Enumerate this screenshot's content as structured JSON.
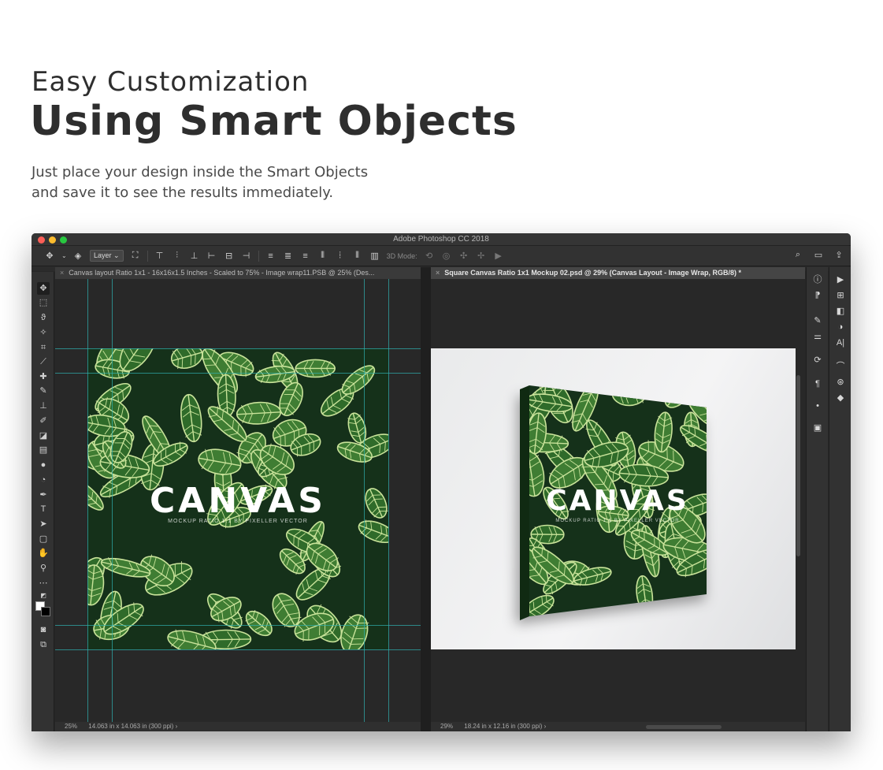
{
  "hero": {
    "subtitle": "Easy Customization",
    "title": "Using Smart Objects",
    "desc_line1": "Just place your design inside the Smart Objects",
    "desc_line2": "and save it to see the results immediately."
  },
  "app": {
    "window_title": "Adobe Photoshop CC 2018",
    "options": {
      "layer_select": "Layer",
      "mode_label": "3D Mode:"
    },
    "documents": [
      {
        "tab_close": "×",
        "tab_label": "Canvas layout Ratio 1x1 - 16x16x1.5 Inches - Scaled to 75% - Image wrap11.PSB @ 25% (Des...",
        "zoom": "25%",
        "doc_size": "14.063 in x 14.063 in (300 ppi)",
        "status_arrow": "›"
      },
      {
        "tab_close": "×",
        "tab_label": "Square Canvas Ratio 1x1 Mockup 02.psd @ 29% (Canvas Layout - Image Wrap, RGB/8) *",
        "zoom": "29%",
        "doc_size": "18.24 in x 12.16 in (300 ppi)",
        "status_arrow": "›"
      }
    ],
    "artwork": {
      "word": "CANVAS",
      "tagline": "MOCKUP RATIO 1:1 BY PIXELLER VECTOR"
    },
    "tools": [
      "move-tool",
      "marquee-tool",
      "lasso-tool",
      "magic-wand-tool",
      "crop-tool",
      "eyedropper-tool",
      "healing-tool",
      "brush-tool",
      "stamp-tool",
      "history-brush-tool",
      "eraser-tool",
      "gradient-tool",
      "blur-tool",
      "dodge-tool",
      "pen-tool",
      "type-tool",
      "path-selection-tool",
      "shape-tool",
      "hand-tool",
      "zoom-tool",
      "more-tools"
    ],
    "colors": {
      "accent_guide": "#2fb0b0",
      "window_bg": "#282828",
      "leaf_dark": "#15311a",
      "leaf_mid": "#2f6b2a",
      "leaf_vein": "#c9e39a"
    }
  }
}
